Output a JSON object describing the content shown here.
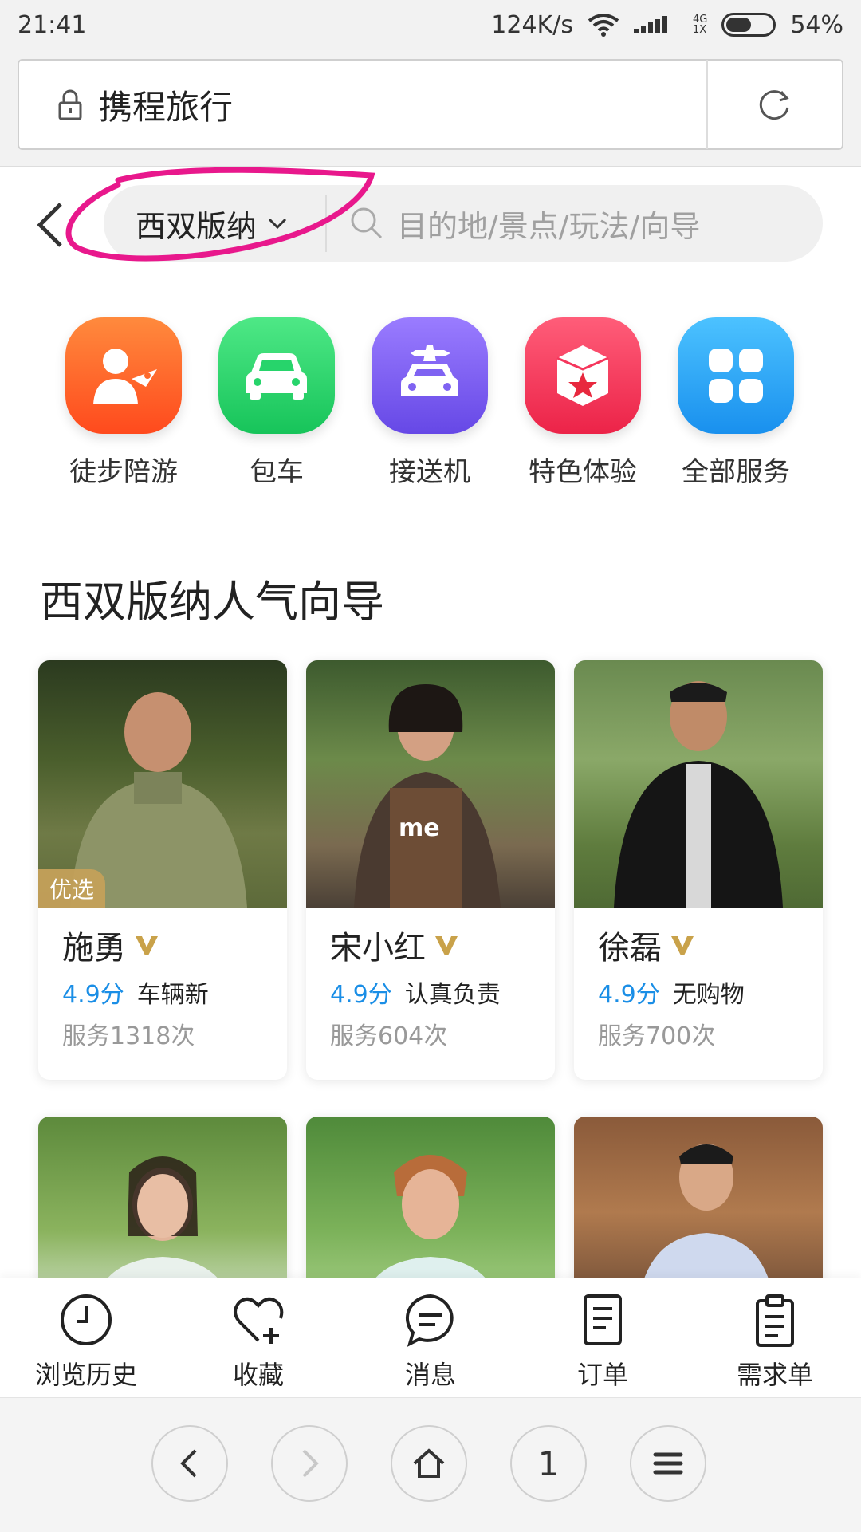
{
  "status_bar": {
    "time": "21:41",
    "net_speed": "124K/s",
    "net_type_top": "4G",
    "net_type_bottom": "1X",
    "battery": "54%",
    "battery_level": 0.54
  },
  "browser": {
    "url_title": "携程旅行",
    "tab_count": "1"
  },
  "search": {
    "city": "西双版纳",
    "placeholder": "目的地/景点/玩法/向导"
  },
  "services": [
    {
      "label": "徒步陪游",
      "icon": "guide-person-icon",
      "color": "#ff6a2b"
    },
    {
      "label": "包车",
      "icon": "car-icon",
      "color": "#27d46b"
    },
    {
      "label": "接送机",
      "icon": "airport-transfer-icon",
      "color": "#7f63f2"
    },
    {
      "label": "特色体验",
      "icon": "star-box-icon",
      "color": "#f5365c"
    },
    {
      "label": "全部服务",
      "icon": "grid-icon",
      "color": "#21a8f5"
    }
  ],
  "section": {
    "title": "西双版纳人气向导"
  },
  "guides": [
    {
      "name": "施勇",
      "rating": "4.9分",
      "tag": "车辆新",
      "count": "服务1318次",
      "badge": "优选"
    },
    {
      "name": "宋小红",
      "rating": "4.9分",
      "tag": "认真负责",
      "count": "服务604次"
    },
    {
      "name": "徐磊",
      "rating": "4.9分",
      "tag": "无购物",
      "count": "服务700次"
    }
  ],
  "bottom_nav": [
    {
      "label": "浏览历史",
      "icon": "clock-icon"
    },
    {
      "label": "收藏",
      "icon": "heart-plus-icon"
    },
    {
      "label": "消息",
      "icon": "message-icon"
    },
    {
      "label": "订单",
      "icon": "order-icon"
    },
    {
      "label": "需求单",
      "icon": "clipboard-icon"
    }
  ],
  "colors": {
    "accent_blue": "#1a8ee6",
    "badge_gold": "#c4a05a",
    "annotation_pink": "#e8188c"
  }
}
